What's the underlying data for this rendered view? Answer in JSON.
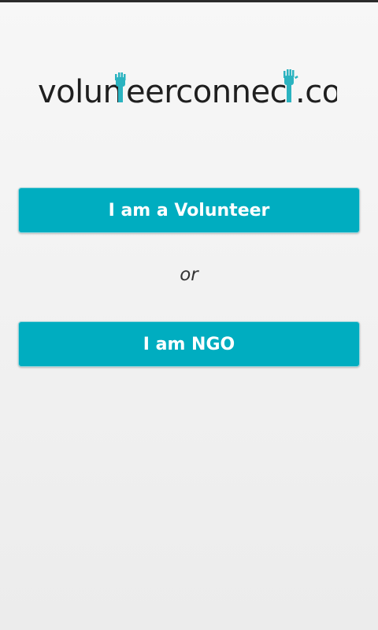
{
  "logo": {
    "text": "volunteerconnect.co",
    "accent_color": "#2bb3c0"
  },
  "buttons": {
    "volunteer_label": "I am a Volunteer",
    "ngo_label": "I am NGO"
  },
  "separator": {
    "or_label": "or"
  },
  "colors": {
    "button_bg": "#00adc0",
    "page_bg": "#f2f2f2"
  }
}
